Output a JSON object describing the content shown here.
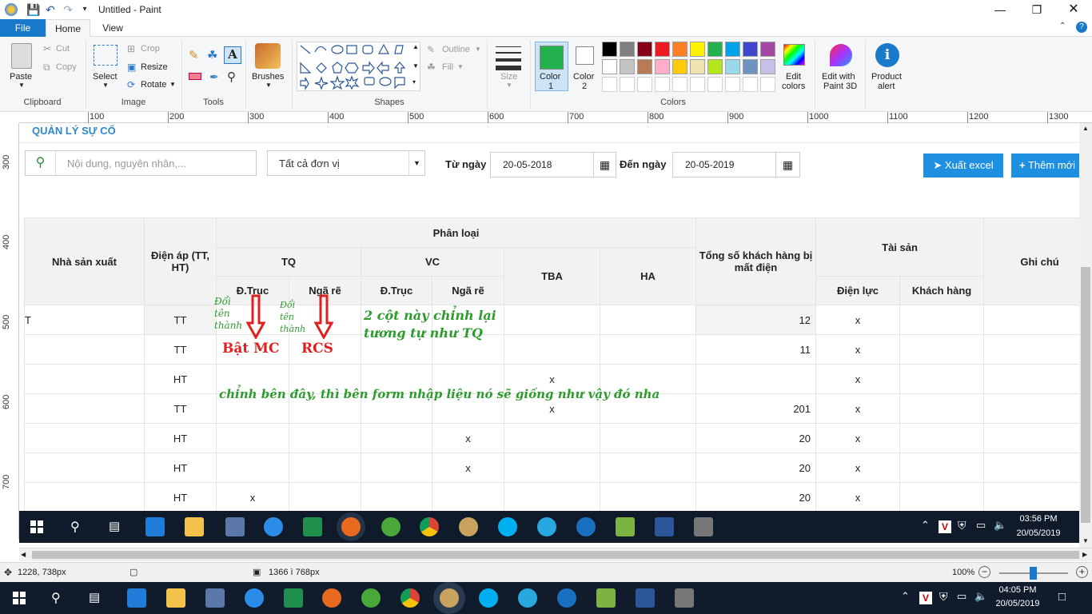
{
  "window": {
    "title": "Untitled - Paint"
  },
  "tabs": {
    "file": "File",
    "home": "Home",
    "view": "View"
  },
  "ribbon": {
    "clipboard": {
      "paste": "Paste",
      "cut": "Cut",
      "copy": "Copy",
      "label": "Clipboard"
    },
    "image": {
      "select": "Select",
      "crop": "Crop",
      "resize": "Resize",
      "rotate": "Rotate",
      "label": "Image"
    },
    "tools": {
      "label": "Tools"
    },
    "brushes": {
      "label": "Brushes"
    },
    "shapes": {
      "outline": "Outline",
      "fill": "Fill",
      "label": "Shapes"
    },
    "size": {
      "label": "Size"
    },
    "colors": {
      "color1": "Color",
      "color1b": "1",
      "color2": "Color",
      "color2b": "2",
      "edit": "Edit",
      "editb": "colors",
      "label": "Colors",
      "palette": [
        "#000000",
        "#7f7f7f",
        "#880015",
        "#ed1c24",
        "#ff7f27",
        "#fff200",
        "#22b14c",
        "#00a2e8",
        "#3f48cc",
        "#a349a4",
        "#ffffff",
        "#c3c3c3",
        "#b97a57",
        "#ffaec9",
        "#ffc90e",
        "#efe4b0",
        "#b5e61d",
        "#99d9ea",
        "#7092be",
        "#c8bfe7"
      ],
      "color1_value": "#22b14c",
      "color2_value": "#ffffff"
    },
    "paint3d": {
      "l1": "Edit with",
      "l2": "Paint 3D"
    },
    "alert": {
      "l1": "Product",
      "l2": "alert"
    }
  },
  "ruler": {
    "h": [
      "100",
      "200",
      "300",
      "400",
      "500",
      "600",
      "700",
      "800",
      "900",
      "1000",
      "1100",
      "1200",
      "1300"
    ],
    "v": [
      "300",
      "400",
      "500",
      "600",
      "700"
    ]
  },
  "page": {
    "title": "QUẢN LÝ SỰ CỐ",
    "search_placeholder": "Nội dung, nguyên nhân,...",
    "unit_select": "Tất cả đơn vị",
    "from_label": "Từ ngày",
    "from_value": "20-05-2018",
    "to_label": "Đến ngày",
    "to_value": "20-05-2019",
    "export_btn": "Xuất excel",
    "add_btn": "Thêm mới"
  },
  "table": {
    "h_manufacturer": "Nhà sản xuất",
    "h_voltage": "Điện áp (TT, HT)",
    "h_classify": "Phân loại",
    "h_tq": "TQ",
    "h_vc": "VC",
    "h_tba": "TBA",
    "h_ha": "HA",
    "h_dtruc": "Đ.Trục",
    "h_ngare": "Ngã rẽ",
    "h_dtruc2": "Đ.Trục",
    "h_ngare2": "Ngã rẽ",
    "h_customers": "Tổng số khách hàng bị mất điện",
    "h_assets": "Tài sản",
    "h_power": "Điện lực",
    "h_client": "Khách hàng",
    "h_note": "Ghi chú",
    "rows": [
      [
        "T",
        "TT",
        "",
        "",
        "",
        "",
        "",
        "",
        "12",
        "x",
        "",
        ""
      ],
      [
        "",
        "TT",
        "",
        "",
        "",
        "",
        "",
        "",
        "11",
        "x",
        "",
        ""
      ],
      [
        "",
        "HT",
        "",
        "",
        "",
        "",
        "x",
        "",
        "",
        "x",
        "",
        ""
      ],
      [
        "",
        "TT",
        "",
        "",
        "",
        "",
        "x",
        "",
        "201",
        "x",
        "",
        ""
      ],
      [
        "",
        "HT",
        "",
        "",
        "",
        "x",
        "",
        "",
        "20",
        "x",
        "",
        ""
      ],
      [
        "",
        "HT",
        "",
        "",
        "",
        "x",
        "",
        "",
        "20",
        "x",
        "",
        ""
      ],
      [
        "",
        "HT",
        "x",
        "",
        "",
        "",
        "",
        "",
        "20",
        "x",
        "",
        ""
      ]
    ]
  },
  "notes": {
    "rename1a": "Đổi",
    "rename1b": "tên",
    "rename1c": "thành",
    "rename2a": "Đổi",
    "rename2b": "tên",
    "rename2c": "thành",
    "bat_mc": "Bật MC",
    "rcs": "RCS",
    "two_cols_1": "2 cột này chỉnh lại",
    "two_cols_2": "tương tự như TQ",
    "form_note": "chỉnh bên đây, thì bên form nhập liệu nó sẽ giống như vậy đó nha"
  },
  "inner_clock": {
    "time": "03:56 PM",
    "date": "20/05/2019"
  },
  "status": {
    "pos": "1228, 738px",
    "size": "1366 ì 768px",
    "zoom": "100%"
  },
  "outer_clock": {
    "time": "04:05 PM",
    "date": "20/05/2019"
  }
}
